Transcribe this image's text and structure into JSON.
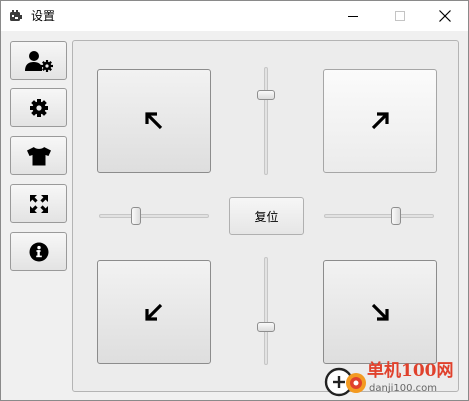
{
  "window": {
    "title": "设置",
    "icon": "app-logo-icon"
  },
  "sidebar": {
    "items": [
      {
        "name": "user-settings",
        "icon": "user-gear-icon"
      },
      {
        "name": "general-settings",
        "icon": "gear-icon"
      },
      {
        "name": "skin",
        "icon": "tshirt-icon"
      },
      {
        "name": "fullscreen",
        "icon": "expand-arrows-icon"
      },
      {
        "name": "about",
        "icon": "info-icon"
      }
    ]
  },
  "panel": {
    "reset_label": "复位",
    "buttons": [
      {
        "name": "top-left",
        "icon": "arrow-up-left-icon"
      },
      {
        "name": "top-right",
        "icon": "arrow-up-right-icon"
      },
      {
        "name": "bottom-left",
        "icon": "arrow-down-left-icon"
      },
      {
        "name": "bottom-right",
        "icon": "arrow-down-right-icon"
      }
    ],
    "sliders": {
      "top_vertical": 0.26,
      "bottom_vertical": 0.65,
      "left_horizontal": 0.34,
      "right_horizontal": 0.65
    }
  },
  "watermark": {
    "brand": "单机100网",
    "url": "danji100.com"
  },
  "colors": {
    "watermark_red": "#e0412c",
    "watermark_orange": "#f39a21"
  }
}
